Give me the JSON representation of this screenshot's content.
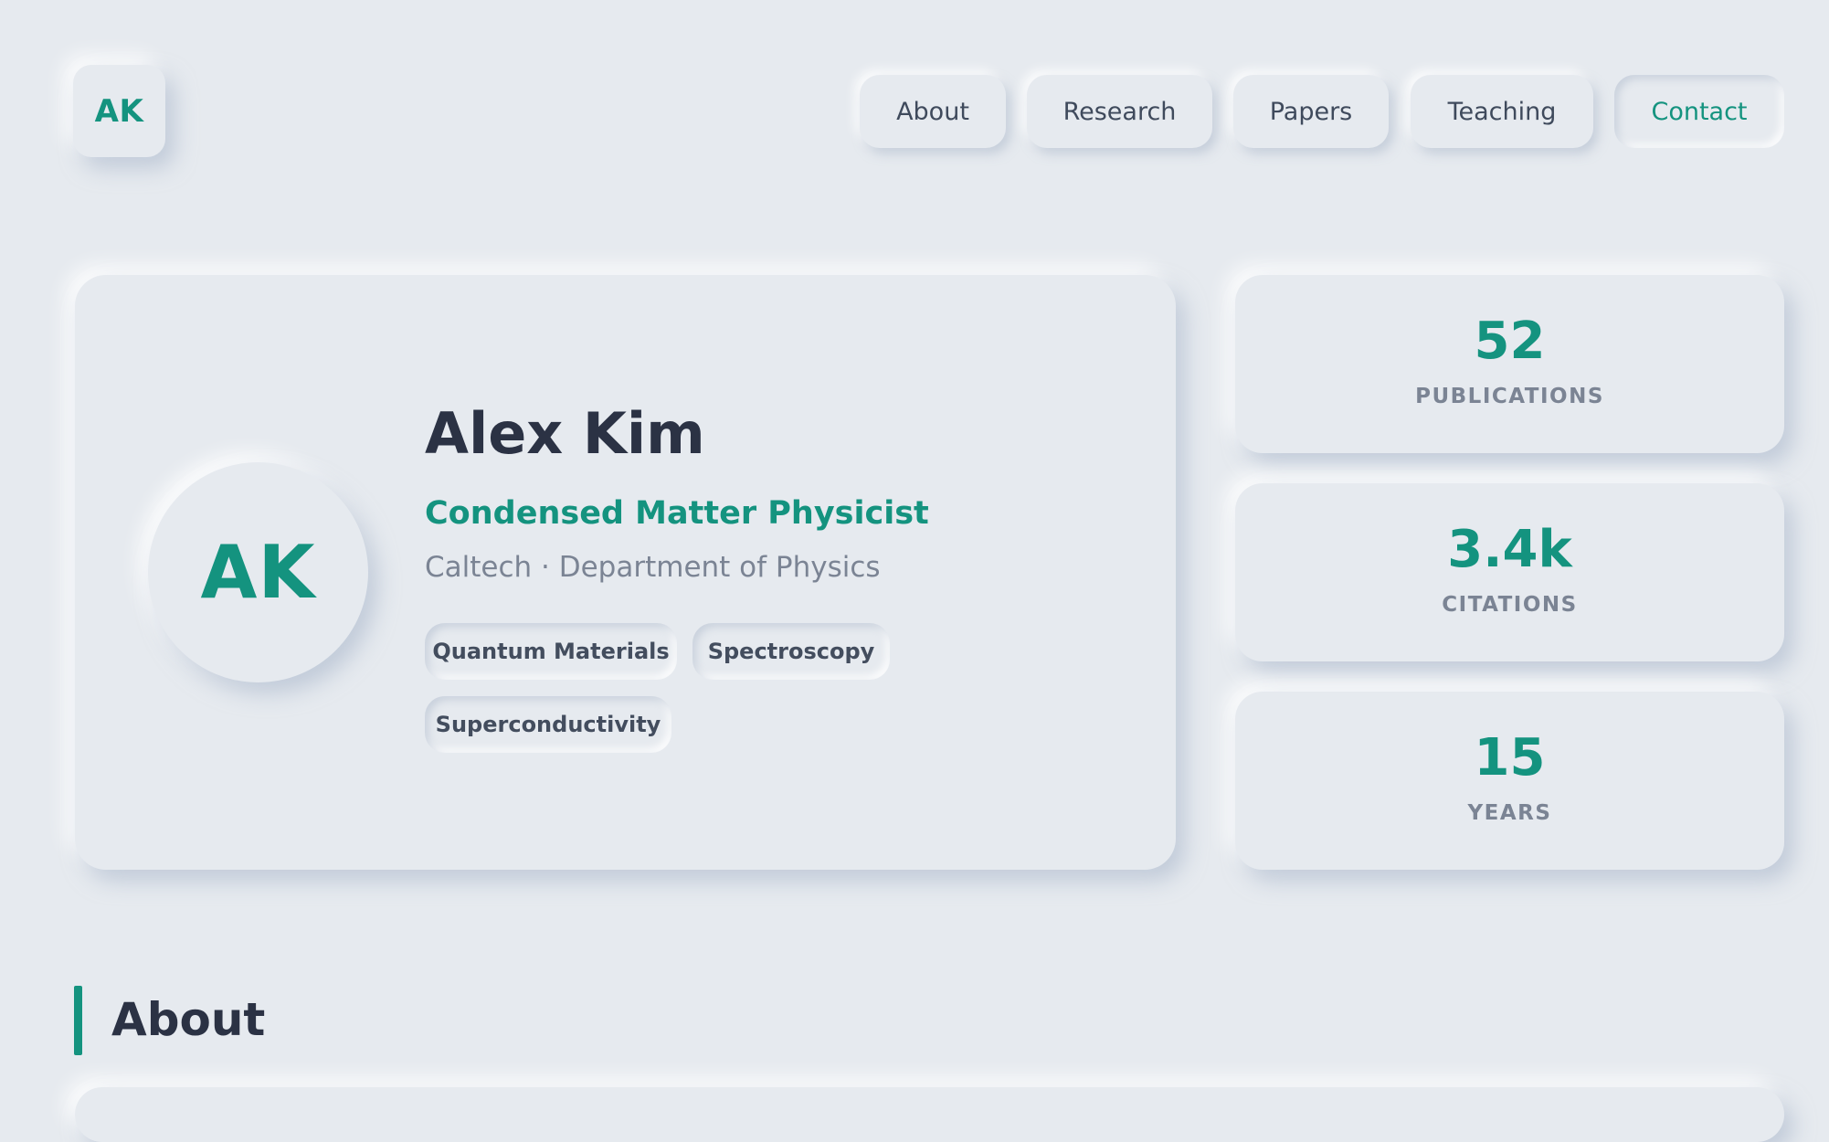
{
  "header": {
    "logo_text": "AK",
    "nav": [
      {
        "label": "About",
        "active": false
      },
      {
        "label": "Research",
        "active": false
      },
      {
        "label": "Papers",
        "active": false
      },
      {
        "label": "Teaching",
        "active": false
      },
      {
        "label": "Contact",
        "active": true
      }
    ]
  },
  "profile": {
    "avatar_initials": "AK",
    "name": "Alex Kim",
    "role": "Condensed Matter Physicist",
    "affiliation": "Caltech · Department of Physics",
    "tags": [
      "Quantum Materials",
      "Spectroscopy",
      "Superconductivity"
    ]
  },
  "stats": [
    {
      "value": "52",
      "label": "PUBLICATIONS"
    },
    {
      "value": "3.4k",
      "label": "CITATIONS"
    },
    {
      "value": "15",
      "label": "YEARS"
    }
  ],
  "section": {
    "title": "About"
  },
  "colors": {
    "accent": "#14937f",
    "background": "#e6eaef",
    "text": "#2b3244",
    "muted": "#7b8494"
  }
}
